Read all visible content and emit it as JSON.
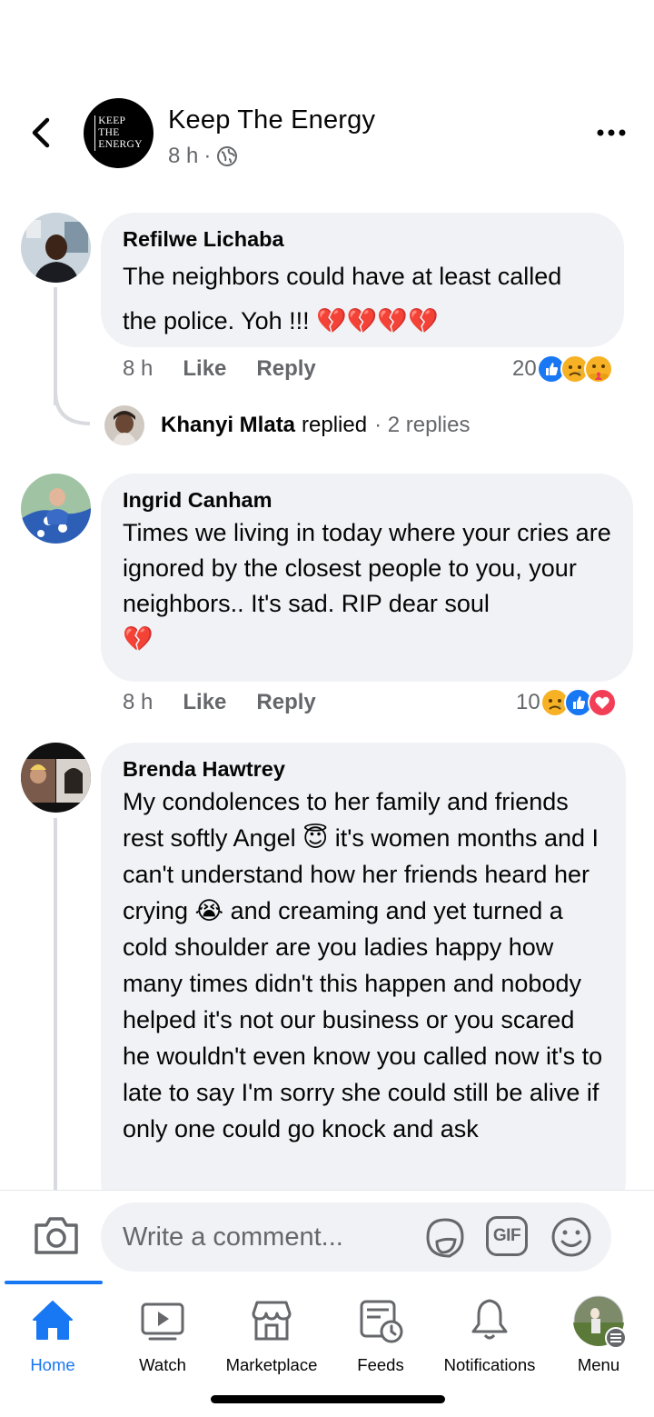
{
  "header": {
    "page_name": "Keep The Energy",
    "time": "8 h",
    "separator": "·",
    "logo_lines": [
      "Keep",
      "The",
      "Energy"
    ],
    "icons": {
      "back": "chevron-left-icon",
      "privacy": "globe-icon",
      "more": "more-dots-icon"
    }
  },
  "comments": [
    {
      "author": "Refilwe Lichaba",
      "text": "The neighbors could have at least called the police. Yoh !!! 💔💔💔💔",
      "time": "8 h",
      "like_label": "Like",
      "reply_label": "Reply",
      "reaction_count": "20",
      "reactions": [
        "like",
        "sad",
        "care"
      ]
    },
    {
      "author": "Ingrid Canham",
      "text": "Times we living in today where your cries are ignored by the closest people to you, your neighbors.. It's sad. RIP dear soul\n💔",
      "time": "8 h",
      "like_label": "Like",
      "reply_label": "Reply",
      "reaction_count": "10",
      "reactions": [
        "sad",
        "like",
        "love"
      ]
    },
    {
      "author": "Brenda Hawtrey",
      "text": "My condolences to her family and friends rest softly Angel 😇 it's women months and I can't understand how her friends heard her  crying 😭 and creaming and yet turned a cold shoulder are you ladies happy how many times didn't this happen and nobody helped it's not our business or you scared he wouldn't even know you called now it's to late to say I'm sorry she could still be alive if only one could go knock and ask"
    }
  ],
  "reply_summary": {
    "name": "Khanyi Mlata",
    "action": "replied",
    "count": "· 2 replies"
  },
  "composer": {
    "placeholder": "Write a comment...",
    "icons": [
      "camera-icon",
      "sticker-icon",
      "gif-icon",
      "emoji-icon"
    ],
    "gif_label": "GIF"
  },
  "tabs": [
    {
      "label": "Home",
      "icon": "home-icon",
      "active": true
    },
    {
      "label": "Watch",
      "icon": "watch-icon",
      "active": false
    },
    {
      "label": "Marketplace",
      "icon": "marketplace-icon",
      "active": false
    },
    {
      "label": "Feeds",
      "icon": "feeds-icon",
      "active": false
    },
    {
      "label": "Notifications",
      "icon": "bell-icon",
      "active": false
    },
    {
      "label": "Menu",
      "icon": "profile-avatar",
      "active": false
    }
  ],
  "colors": {
    "accent": "#1877f2",
    "bubble": "#f0f2f5",
    "secondary_text": "#65676b",
    "like": "#1877f2",
    "love": "#f33e58",
    "sad": "#f7b125"
  }
}
